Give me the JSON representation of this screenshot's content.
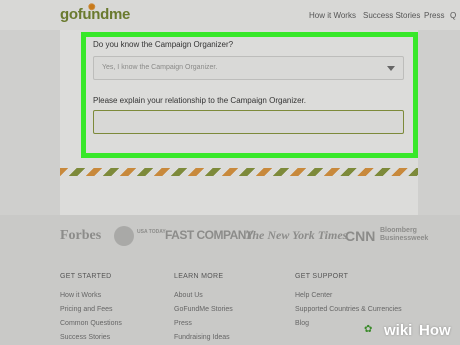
{
  "header": {
    "logo": "gofundme",
    "nav": [
      "How it Works",
      "Success Stories",
      "Press",
      "Q"
    ]
  },
  "form": {
    "question1": "Do you know the Campaign Organizer?",
    "select_value": "Yes, I know the Campaign Organizer.",
    "question2": "Please explain your relationship to the Campaign Organizer.",
    "text_value": ""
  },
  "press_logos": [
    "Forbes",
    "USA TODAY",
    "FAST COMPANY",
    "The New York Times",
    "CNN",
    "Bloomberg Businessweek"
  ],
  "footer": {
    "get_started": {
      "heading": "GET STARTED",
      "items": [
        "How it Works",
        "Pricing and Fees",
        "Common Questions",
        "Success Stories"
      ]
    },
    "learn_more": {
      "heading": "LEARN MORE",
      "items": [
        "About Us",
        "GoFundMe Stories",
        "Press",
        "Fundraising Ideas"
      ]
    },
    "get_support": {
      "heading": "GET SUPPORT",
      "items": [
        "Help Center",
        "Supported Countries & Currencies",
        "Blog"
      ]
    }
  },
  "watermark": {
    "wiki": "wiki",
    "how": "How"
  },
  "colors": {
    "highlight": "#38e82a",
    "brand_green": "#6a7a2e",
    "brand_orange": "#c97a1a"
  }
}
